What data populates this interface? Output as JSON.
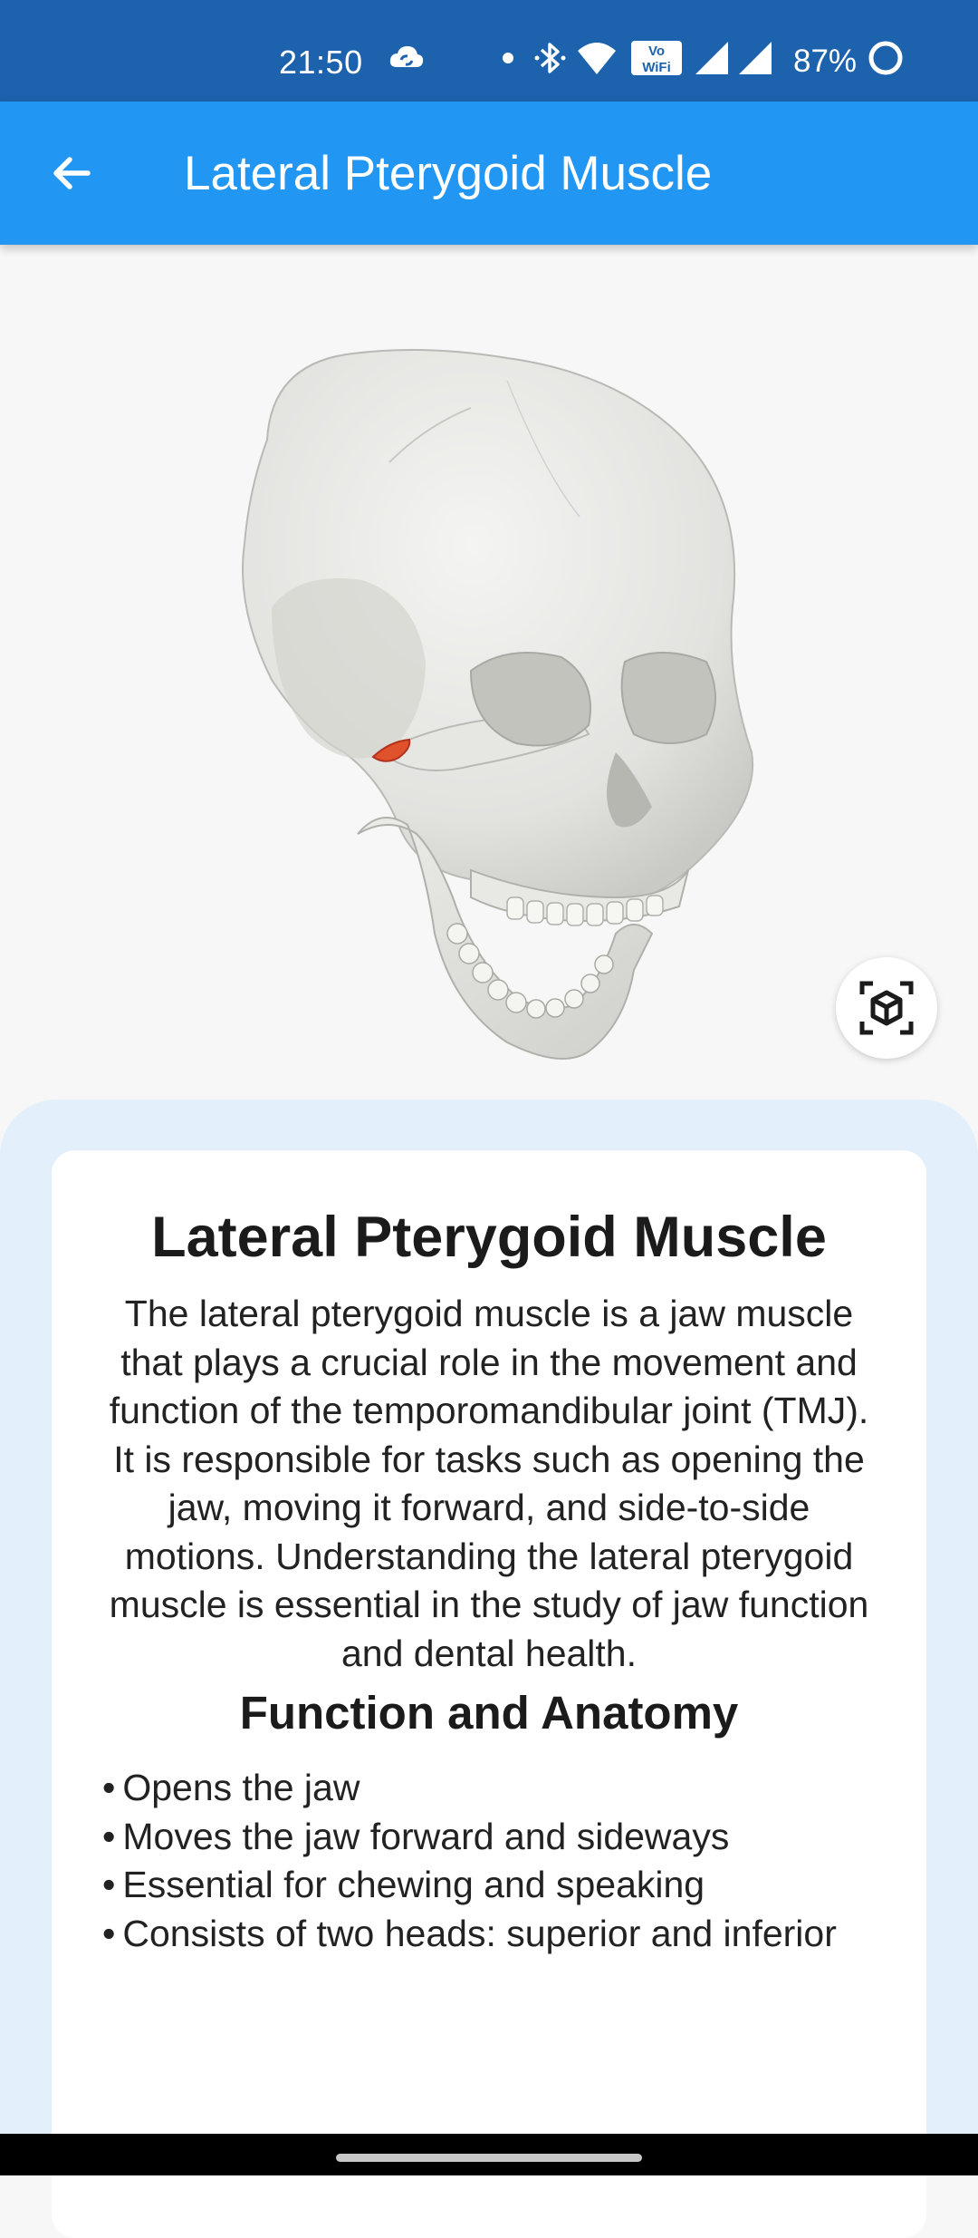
{
  "status_bar": {
    "time": "21:50",
    "battery_percent": "87%",
    "icons": [
      "cloud-sync-icon",
      "dot-icon",
      "bluetooth-icon",
      "wifi-icon",
      "vowifi-icon",
      "signal-icon",
      "signal-icon",
      "battery-saver-icon"
    ]
  },
  "app_bar": {
    "title": "Lateral Pterygoid Muscle",
    "back_icon": "arrow-left-icon"
  },
  "viewer": {
    "ar_icon": "view-in-ar-icon",
    "highlight_color": "#e0522b"
  },
  "card": {
    "title": "Lateral Pterygoid Muscle",
    "description": "The lateral pterygoid muscle is a jaw muscle that plays a crucial role in the movement and function of the temporomandibular joint (TMJ). It is responsible for tasks such as opening the jaw, moving it forward, and side-to-side motions. Understanding the lateral pterygoid muscle is essential in the study of jaw function and dental health.",
    "section_heading": "Function and Anatomy",
    "bullet_char": "•",
    "bullets": [
      "Opens the jaw",
      "Moves the jaw forward and sideways",
      "Essential for chewing and speaking",
      "Consists of two heads: superior and inferior"
    ]
  },
  "colors": {
    "status_bar": "#1c62ad",
    "app_bar": "#2196f3",
    "sheet_background": "#e3f0fc",
    "card_background": "#ffffff"
  }
}
